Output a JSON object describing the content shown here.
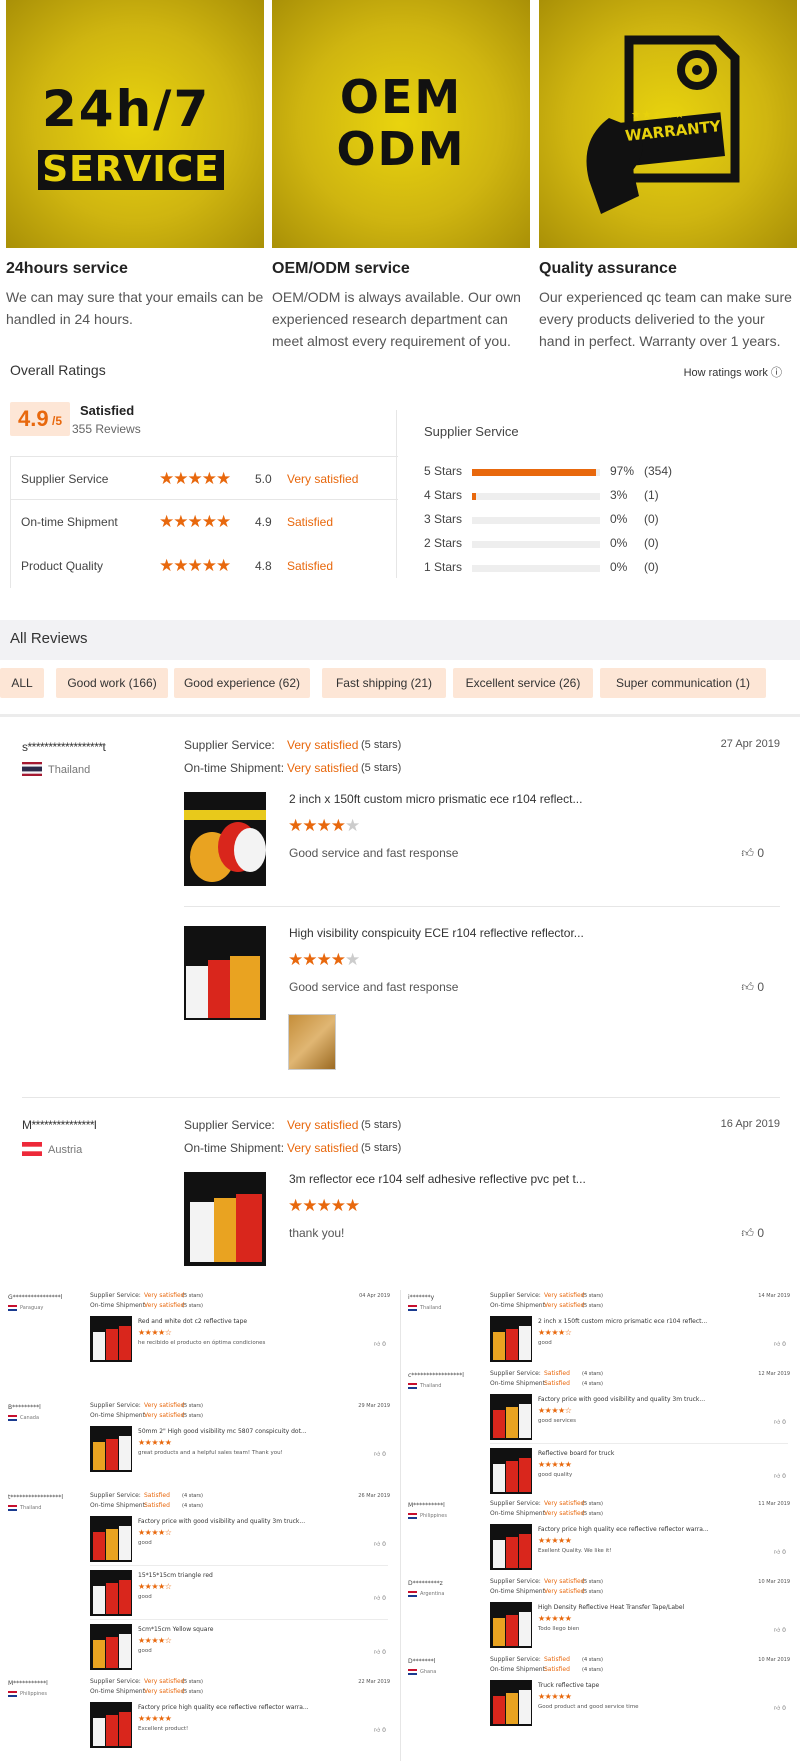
{
  "services": [
    {
      "title": "24hours service",
      "desc": "We can may sure that your emails can be handled in 24 hours.",
      "art_line1": "24h/7",
      "art_line2": "SERVICE"
    },
    {
      "title": "OEM/ODM service",
      "desc": "OEM/ODM is always available. Our own experienced research department can meet almost every requirement of you.",
      "art_line1": "OEM",
      "art_line2": "ODM"
    },
    {
      "title": "Quality assurance",
      "desc": "Our experienced qc team can make sure every products deliveried to the your hand in perfect.  Warranty over 1 years.",
      "art_line1": "★★★★★",
      "art_line2": "WARRANTY"
    }
  ],
  "ratings": {
    "heading": "Overall Ratings",
    "how_link": "How ratings work",
    "score": "4.9",
    "score_of": "/5",
    "label": "Satisfied",
    "reviews": "355 Reviews",
    "rows": [
      {
        "label": "Supplier Service",
        "stars": "★★★★★",
        "value": "5.0",
        "word": "Very satisfied"
      },
      {
        "label": "On-time Shipment",
        "stars": "★★★★★",
        "value": "4.9",
        "word": "Satisfied"
      },
      {
        "label": "Product Quality",
        "stars": "★★★★★",
        "value": "4.8",
        "word": "Satisfied"
      }
    ],
    "dist_title": "Supplier Service",
    "dist": [
      {
        "label": "5 Stars",
        "fraction": 0.97,
        "pct": "97%",
        "count": "(354)"
      },
      {
        "label": "4 Stars",
        "fraction": 0.03,
        "pct": "3%",
        "count": "(1)"
      },
      {
        "label": "3 Stars",
        "fraction": 0,
        "pct": "0%",
        "count": "(0)"
      },
      {
        "label": "2 Stars",
        "fraction": 0,
        "pct": "0%",
        "count": "(0)"
      },
      {
        "label": "1 Stars",
        "fraction": 0,
        "pct": "0%",
        "count": "(0)"
      }
    ]
  },
  "all_reviews": {
    "heading": "All Reviews",
    "tags": [
      "ALL",
      "Good work (166)",
      "Good experience (62)",
      "Fast shipping (21)",
      "Excellent service (26)",
      "Super communication (1)"
    ]
  },
  "reviews": [
    {
      "user": "s******************t",
      "country": "Thailand",
      "supplier_label": "Supplier Service:",
      "supplier_value": "Very satisfied",
      "supplier_stars": "(5 stars)",
      "shipment_label": "On-time Shipment:",
      "shipment_value": "Very satisfied",
      "shipment_stars": "(5 stars)",
      "date": "27 Apr 2019",
      "products": [
        {
          "title": "2 inch x 150ft custom micro prismatic ece r104 reflect...",
          "rating": 4,
          "comment": "Good service and fast response",
          "likes": "0"
        },
        {
          "title": "High visibility conspicuity ECE r104 reflective reflector...",
          "rating": 4,
          "comment": "Good service and fast response",
          "likes": "0"
        }
      ]
    },
    {
      "user": "M***************l",
      "country": "Austria",
      "supplier_label": "Supplier Service:",
      "supplier_value": "Very satisfied",
      "supplier_stars": "(5 stars)",
      "shipment_label": "On-time Shipment:",
      "shipment_value": "Very satisfied",
      "shipment_stars": "(5 stars)",
      "date": "16 Apr 2019",
      "products": [
        {
          "title": "3m reflector ece r104 self adhesive reflective pvc pet t...",
          "rating": 5,
          "comment": "thank you!",
          "likes": "0"
        }
      ]
    }
  ],
  "collage": {
    "labels": {
      "supplier": "Supplier Service:",
      "shipment": "On-time Shipment:",
      "vs": "Very satisfied",
      "s": "Satisfied",
      "five": "(5 stars)",
      "four": "(4 stars)"
    },
    "left": [
      {
        "user": "G****************l",
        "country": "Paraguay",
        "date": "04 Apr 2019",
        "items": [
          {
            "title": "Red and white dot c2 reflective tape",
            "comment": "he recibido el producto en óptima condiciones",
            "stars": "★★★★☆"
          }
        ]
      },
      {
        "user": "B*********l",
        "country": "Canada",
        "date": "29 Mar 2019",
        "items": [
          {
            "title": "50mm 2\" High good visibility mc 5807 conspicuity dot...",
            "comment": "great products and a helpful sales team! Thank you!",
            "stars": "★★★★★"
          }
        ]
      },
      {
        "user": "t*****************l",
        "country": "Thailand",
        "date": "26 Mar 2019",
        "items": [
          {
            "title": "Factory price with good visibility and quality 3m truck...",
            "comment": "good",
            "stars": "★★★★☆"
          },
          {
            "title": "15*15*15cm triangle red",
            "comment": "good",
            "stars": "★★★★☆"
          },
          {
            "title": "5cm*15cm Yellow square",
            "comment": "good",
            "stars": "★★★★☆"
          }
        ]
      },
      {
        "user": "M***********l",
        "country": "Philippines",
        "date": "22 Mar 2019",
        "items": [
          {
            "title": "Factory price high quality ece reflective reflector warra...",
            "comment": "Excellent product!",
            "stars": "★★★★★"
          }
        ]
      }
    ],
    "right": [
      {
        "user": "i*******y",
        "country": "Thailand",
        "date": "14 Mar 2019",
        "items": [
          {
            "title": "2 inch x 150ft custom micro prismatic ece r104 reflect...",
            "comment": "good",
            "stars": "★★★★☆"
          }
        ]
      },
      {
        "user": "c*****************l",
        "country": "Thailand",
        "date": "12 Mar 2019",
        "items": [
          {
            "title": "Factory price with good visibility and quality 3m truck...",
            "comment": "good services",
            "stars": "★★★★☆"
          },
          {
            "title": "Reflective board for truck",
            "comment": "good quality",
            "stars": "★★★★★"
          }
        ]
      },
      {
        "user": "M**********l",
        "country": "Philippines",
        "date": "11 Mar 2019",
        "items": [
          {
            "title": "Factory price high quality ece reflective reflector warra...",
            "comment": "Exellent Quality. We like it!",
            "stars": "★★★★★"
          }
        ]
      },
      {
        "user": "D*********z",
        "country": "Argentina",
        "date": "10 Mar 2019",
        "items": [
          {
            "title": "High Density Reflective Heat Transfer Tape/Label",
            "comment": "Todo llego bien",
            "stars": "★★★★★"
          }
        ]
      },
      {
        "user": "D*******l",
        "country": "Ghana",
        "date": "10 Mar 2019",
        "items": [
          {
            "title": "Truck reflective tape",
            "comment": "Good product and good service time",
            "stars": "★★★★★"
          }
        ]
      }
    ]
  },
  "colors": {
    "accent": "#e8680d",
    "badge_bg": "#fde6d6",
    "banner": "#d4bb0f"
  },
  "icons": {
    "thumb": "thumbs-up-icon",
    "help": "question-circle-icon",
    "flag": "country-flag-icon"
  }
}
